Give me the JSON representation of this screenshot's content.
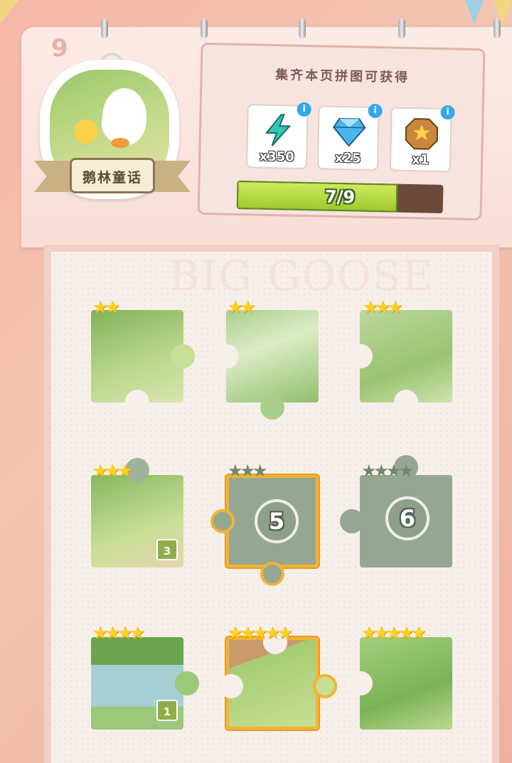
{
  "book": {
    "page_number": "9",
    "title": "鹅林童话",
    "watermark": "BIG GOOSE"
  },
  "rewards": {
    "title": "集齐本页拼图可获得",
    "info_label": "i",
    "items": [
      {
        "icon": "energy-bolt-icon",
        "qty": "x350",
        "color": "#2fc7b7"
      },
      {
        "icon": "diamond-icon",
        "qty": "x25",
        "color": "#4ab6ee"
      },
      {
        "icon": "treasure-chest-icon",
        "qty": "x1",
        "color": "#c9873b"
      }
    ]
  },
  "progress": {
    "label": "7/9",
    "collected": 7,
    "total": 9
  },
  "pieces": [
    {
      "id": 1,
      "stars": 2,
      "state": "unlocked",
      "count": ""
    },
    {
      "id": 2,
      "stars": 2,
      "state": "unlocked",
      "count": ""
    },
    {
      "id": 3,
      "stars": 3,
      "state": "unlocked",
      "count": ""
    },
    {
      "id": 4,
      "stars": 3,
      "state": "unlocked",
      "count": "3"
    },
    {
      "id": 5,
      "stars": 3,
      "state": "locked",
      "label": "5",
      "highlight": true
    },
    {
      "id": 6,
      "stars": 4,
      "state": "locked",
      "label": "6"
    },
    {
      "id": 7,
      "stars": 4,
      "state": "unlocked",
      "count": "1"
    },
    {
      "id": 8,
      "stars": 5,
      "state": "unlocked",
      "count": "",
      "highlight": true
    },
    {
      "id": 9,
      "stars": 5,
      "state": "unlocked",
      "count": ""
    }
  ],
  "colors": {
    "star_gold": "#ffd21f",
    "star_locked": "#6d8a6d",
    "progress_fill": "#a9d23a",
    "highlight_border": "#f1b434"
  }
}
